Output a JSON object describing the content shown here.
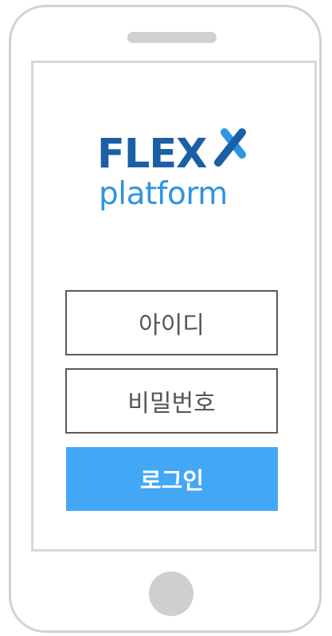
{
  "logo": {
    "wordmark": "FLEX",
    "subtitle": "platform",
    "colors": {
      "wordmark": "#1a5fa7",
      "subtitle": "#2f95e0",
      "x_accent": "#2f95e0"
    }
  },
  "login_form": {
    "id_placeholder": "아이디",
    "password_placeholder": "비밀번호",
    "login_button_label": "로그인"
  },
  "colors": {
    "primary_button": "#42a7f5",
    "device_frame": "#d2d2d2",
    "field_border": "#5a5a5a"
  }
}
